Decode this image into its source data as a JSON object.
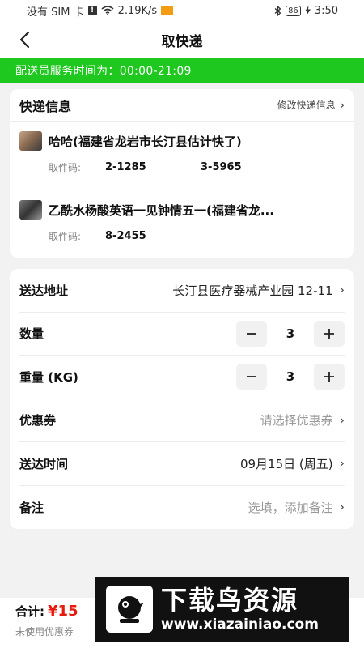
{
  "status_bar": {
    "carrier": "没有 SIM 卡",
    "speed": "2.19K/s",
    "battery": "86",
    "time": "3:50"
  },
  "nav": {
    "title": "取快递"
  },
  "service_banner": "配送员服务时间为：00:00-21:09",
  "express_info": {
    "title": "快递信息",
    "edit_label": "修改快递信息",
    "packages": [
      {
        "name": "哈哈(福建省龙岩市长汀县估计快了)",
        "code_label": "取件码:",
        "codes": [
          "2-1285",
          "3-5965"
        ]
      },
      {
        "name": "乙酰水杨酸英语一见钟情五一(福建省龙...",
        "code_label": "取件码:",
        "codes": [
          "8-2455"
        ]
      }
    ]
  },
  "form": {
    "address_label": "送达地址",
    "address_value": "长汀县医疗器械产业园 12-11",
    "quantity_label": "数量",
    "quantity_value": "3",
    "weight_label": "重量 (KG)",
    "weight_value": "3",
    "coupon_label": "优惠券",
    "coupon_placeholder": "请选择优惠券",
    "time_label": "送达时间",
    "time_value": "09月15日 (周五)",
    "note_label": "备注",
    "note_placeholder": "选填，添加备注"
  },
  "bottom": {
    "total_label": "合计:",
    "total_amount": "¥15",
    "coupon_note": "未使用优惠券"
  },
  "watermark": {
    "title": "下载鸟资源",
    "url": "www.xiazainiao.com"
  },
  "colors": {
    "brand_green": "#1ec81e",
    "price_red": "#e8190f"
  }
}
